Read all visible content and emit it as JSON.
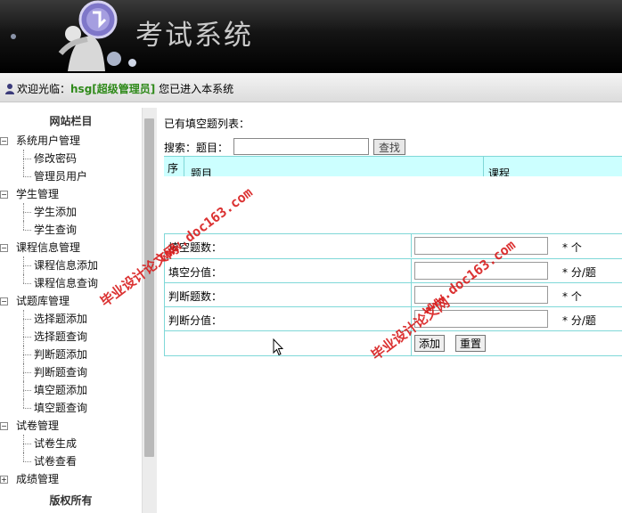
{
  "header": {
    "title": "考试系统"
  },
  "welcome": {
    "prefix": "欢迎光临：",
    "user": "hsg[超级管理员]",
    "suffix": " 您已进入本系统"
  },
  "sidebar": {
    "title": "网站栏目",
    "groups": [
      {
        "label": "系统用户管理",
        "toggle": "−",
        "items": [
          "修改密码",
          "管理员用户"
        ]
      },
      {
        "label": "学生管理",
        "toggle": "−",
        "items": [
          "学生添加",
          "学生查询"
        ]
      },
      {
        "label": "课程信息管理",
        "toggle": "−",
        "items": [
          "课程信息添加",
          "课程信息查询"
        ]
      },
      {
        "label": "试题库管理",
        "toggle": "−",
        "items": [
          "选择题添加",
          "选择题查询",
          "判断题添加",
          "判断题查询",
          "填空题添加",
          "填空题查询"
        ]
      },
      {
        "label": "试卷管理",
        "toggle": "−",
        "items": [
          "试卷生成",
          "试卷查看"
        ]
      },
      {
        "label": "成绩管理",
        "toggle": "+",
        "items": []
      }
    ],
    "copyright": "版权所有"
  },
  "main": {
    "list_title": "已有填空题列表：",
    "search": {
      "label": "搜索：题目：",
      "value": "",
      "button": "查找"
    },
    "table_headers": [
      "序",
      "题目",
      "课程"
    ],
    "form": {
      "rows": [
        {
          "label": "填空题数：",
          "value": "",
          "unit": "* 个"
        },
        {
          "label": "填空分值：",
          "value": "",
          "unit": "* 分/题"
        },
        {
          "label": "判断题数：",
          "value": "",
          "unit": "* 个"
        },
        {
          "label": "判断分值：",
          "value": "",
          "unit": "* 分/题"
        }
      ],
      "add_button": "添加",
      "reset_button": "重置"
    }
  },
  "watermarks": {
    "url": "www.doc163.com",
    "text": "毕业设计论文网"
  },
  "colors": {
    "table_header_bg": "#ccffff",
    "table_border": "#7fd8d8",
    "username": "#2f8a1a",
    "watermark": "#d81c1c"
  }
}
